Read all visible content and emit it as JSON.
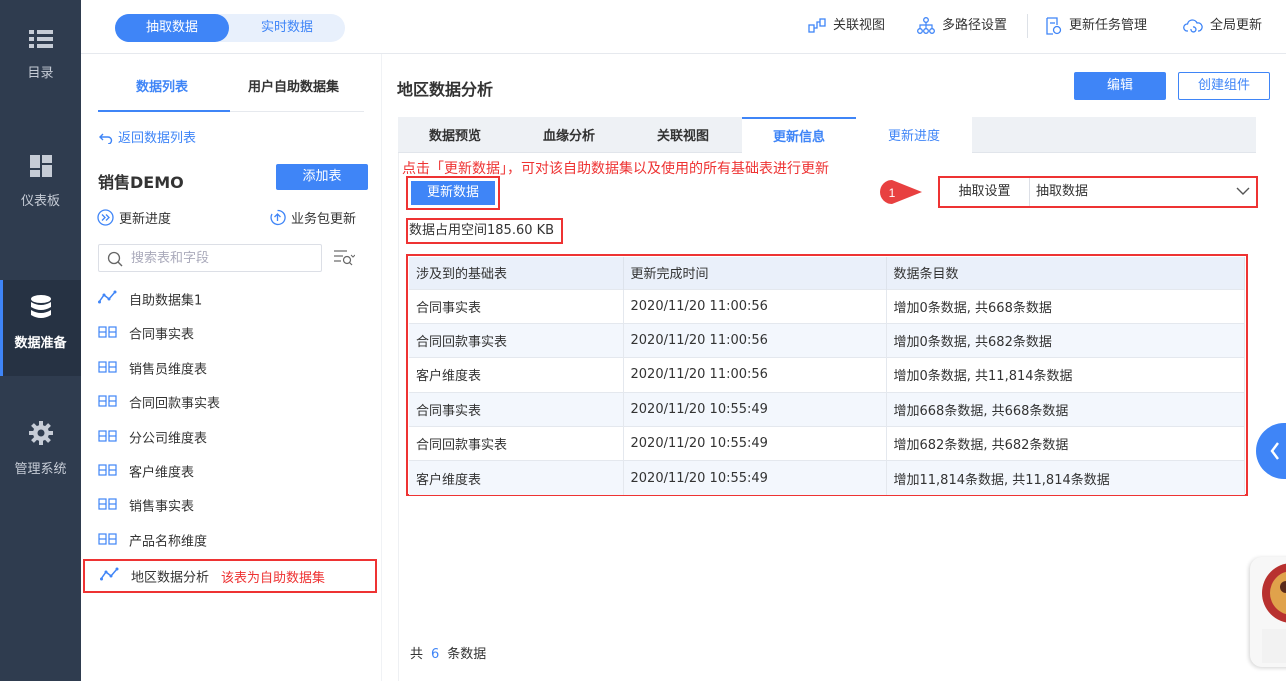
{
  "nav": [
    {
      "label": "目录",
      "icon": "list-icon"
    },
    {
      "label": "仪表板",
      "icon": "dashboard-icon"
    },
    {
      "label": "数据准备",
      "icon": "database-icon"
    },
    {
      "label": "管理系统",
      "icon": "gear-icon"
    }
  ],
  "top": {
    "seg_on": "抽取数据",
    "seg_off": "实时数据",
    "tools": [
      "关联视图",
      "多路径设置",
      "更新任务管理",
      "全局更新"
    ]
  },
  "list": {
    "tab_on": "数据列表",
    "tab_off": "用户自助数据集",
    "back": "返回数据列表",
    "group": "销售DEMO",
    "add_table": "添加表",
    "progress": "更新进度",
    "package_update": "业务包更新",
    "search_placeholder": "搜索表和字段",
    "items": [
      {
        "label": "自助数据集1",
        "type": "self-service"
      },
      {
        "label": "合同事实表",
        "type": "table"
      },
      {
        "label": "销售员维度表",
        "type": "table"
      },
      {
        "label": "合同回款事实表",
        "type": "table"
      },
      {
        "label": "分公司维度表",
        "type": "table"
      },
      {
        "label": "客户维度表",
        "type": "table"
      },
      {
        "label": "销售事实表",
        "type": "table"
      },
      {
        "label": "产品名称维度",
        "type": "table"
      }
    ],
    "selected": {
      "label": "地区数据分析",
      "note": "该表为自助数据集"
    }
  },
  "main": {
    "title": "地区数据分析",
    "edit": "编辑",
    "create": "创建组件",
    "tabs": [
      "数据预览",
      "血缘分析",
      "关联视图",
      "更新信息",
      "更新进度"
    ],
    "annotation": "点击「更新数据」，可对该自助数据集以及使用的所有基础表进行更新",
    "update_button": "更新数据",
    "badge": "1",
    "extract_label": "抽取设置",
    "extract_value": "抽取数据",
    "size": "数据占用空间185.60 KB",
    "columns": [
      "涉及到的基础表",
      "更新完成时间",
      "数据条目数"
    ],
    "rows": [
      [
        "合同事实表",
        "2020/11/20 11:00:56",
        "增加0条数据, 共668条数据"
      ],
      [
        "合同回款事实表",
        "2020/11/20 11:00:56",
        "增加0条数据, 共682条数据"
      ],
      [
        "客户维度表",
        "2020/11/20 11:00:56",
        "增加0条数据, 共11,814条数据"
      ],
      [
        "合同事实表",
        "2020/11/20 10:55:49",
        "增加668条数据, 共668条数据"
      ],
      [
        "合同回款事实表",
        "2020/11/20 10:55:49",
        "增加682条数据, 共682条数据"
      ],
      [
        "客户维度表",
        "2020/11/20 10:55:49",
        "增加11,814条数据, 共11,814条数据"
      ]
    ],
    "footer_prefix": "共",
    "footer_count": "6",
    "footer_suffix": "条数据"
  },
  "colors": {
    "accent": "#3f85f7",
    "annotation": "#ee3333",
    "nav_bg": "#2f3c4f"
  }
}
